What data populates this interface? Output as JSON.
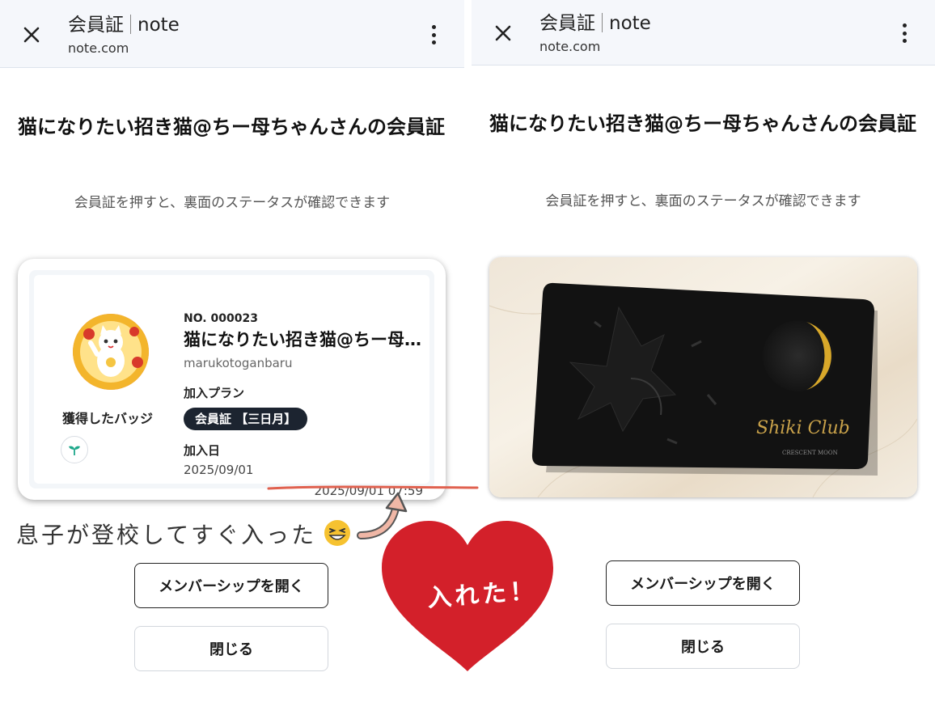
{
  "screens": [
    {
      "appbar": {
        "title": "会員証",
        "site": "note",
        "url": "note.com"
      },
      "heading": "猫になりたい招き猫@ちー母ちゃんさんの会員証",
      "subtext": "会員証を押すと、裏面のステータスが確認できます",
      "card": {
        "badges_label": "獲得したバッジ",
        "number": "NO. 000023",
        "name": "猫になりたい招き猫@ちー母…",
        "username": "marukotoganbaru",
        "plan_label": "加入プラン",
        "plan": "会員証 【三日月】",
        "join_label": "加入日",
        "join_date": "2025/09/01",
        "timestamp": "2025/09/01 07:59"
      },
      "buttons": {
        "open": "メンバーシップを開く",
        "close": "閉じる"
      }
    },
    {
      "appbar": {
        "title": "会員証",
        "site": "note",
        "url": "note.com"
      },
      "heading": "猫になりたい招き猫@ちー母ちゃんさんの会員証",
      "subtext": "会員証を押すと、裏面のステータスが確認できます",
      "card_image": {
        "signature": "Shiki Club",
        "caption": "CRESCENT MOON"
      },
      "buttons": {
        "open": "メンバーシップを開く",
        "close": "閉じる"
      }
    }
  ],
  "annotations": {
    "caption": "息子が登校してすぐ入った",
    "heart_text": "入れた！",
    "heart_color": "#d3202a",
    "underline_color": "#e0614f"
  }
}
